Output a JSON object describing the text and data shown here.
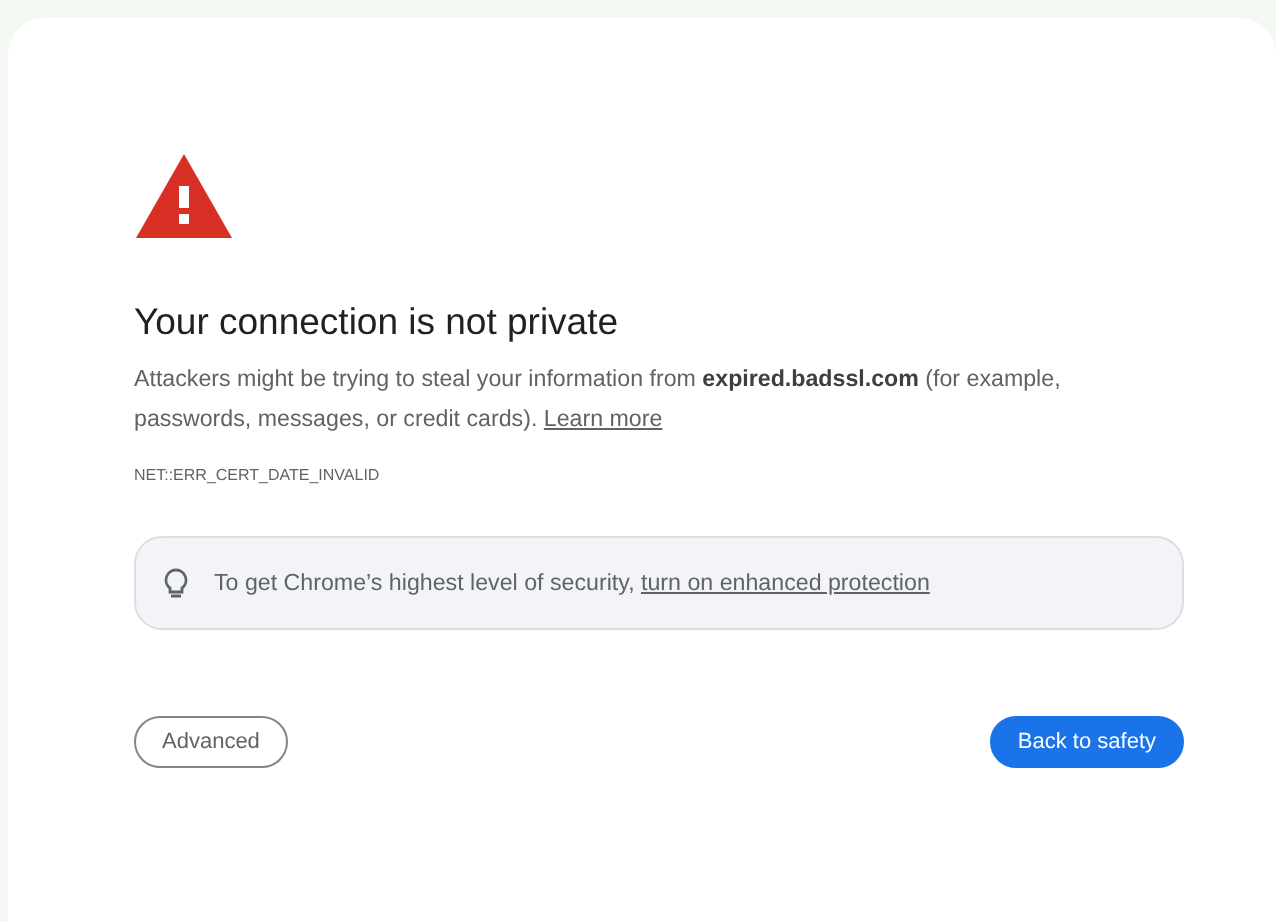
{
  "heading": "Your connection is not private",
  "explanation": {
    "text": "Attackers might be trying to steal your information from **expired.badssl.com** (for example, passwords, messages, or credit cards).",
    "link": "Learn more"
  },
  "error_code": "NET::ERR_CERT_DATE_INVALID",
  "tip": {
    "text": "To get Chrome’s highest level of security,",
    "link": "turn on enhanced protection"
  },
  "buttons": [
    {
      "label": "Advanced",
      "kind": "secondary"
    },
    {
      "label": "Back to safety",
      "kind": "primary"
    }
  ]
}
